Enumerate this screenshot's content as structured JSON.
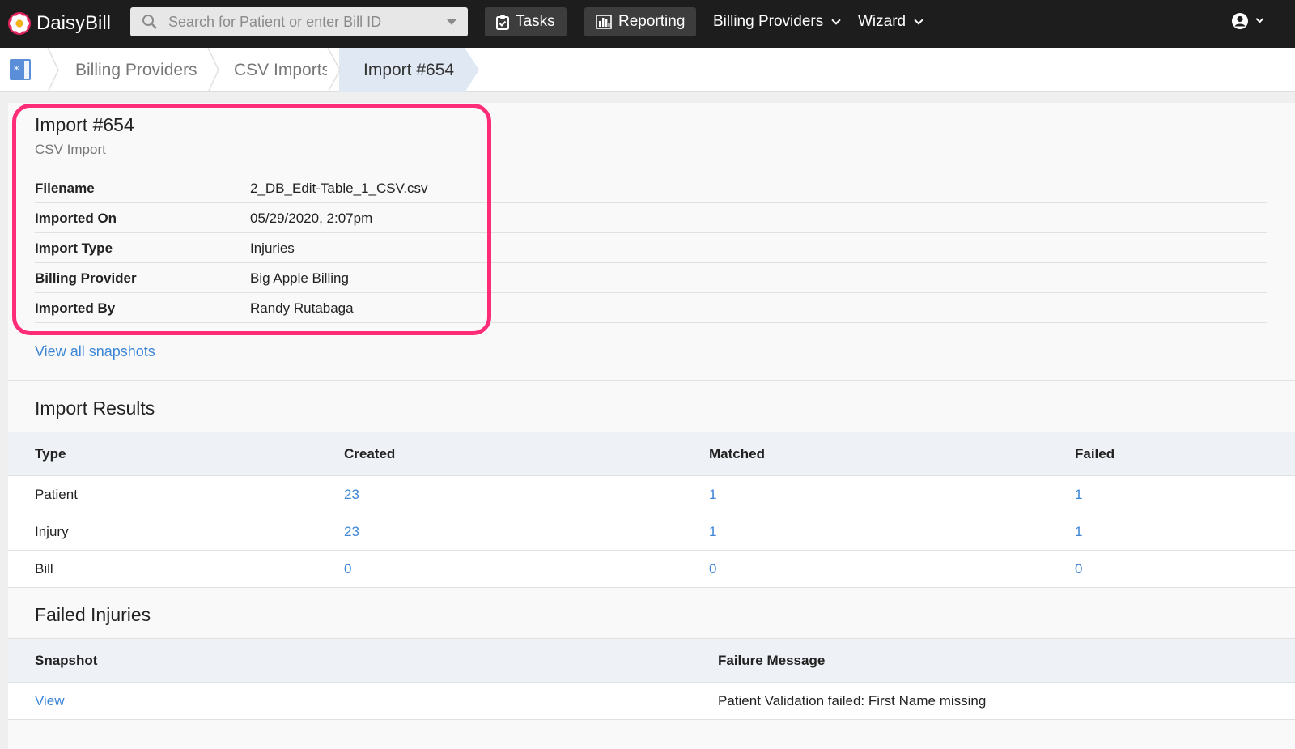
{
  "app": {
    "brand": "DaisyBill"
  },
  "search": {
    "placeholder": "Search for Patient or enter Bill ID"
  },
  "nav": {
    "tasks": "Tasks",
    "reporting": "Reporting",
    "billing_providers": "Billing Providers",
    "wizard": "Wizard"
  },
  "breadcrumb": [
    "Billing Providers",
    "CSV Imports",
    "Import #654"
  ],
  "import": {
    "title": "Import #654",
    "subtitle": "CSV Import",
    "fields": [
      {
        "label": "Filename",
        "value": "2_DB_Edit-Table_1_CSV.csv"
      },
      {
        "label": "Imported On",
        "value": "05/29/2020, 2:07pm"
      },
      {
        "label": "Import Type",
        "value": "Injuries"
      },
      {
        "label": "Billing Provider",
        "value": "Big Apple Billing"
      },
      {
        "label": "Imported By",
        "value": "Randy Rutabaga"
      }
    ],
    "view_snapshots": "View all snapshots"
  },
  "results": {
    "title": "Import Results",
    "columns": [
      "Type",
      "Created",
      "Matched",
      "Failed"
    ],
    "rows": [
      [
        "Patient",
        "23",
        "1",
        "1"
      ],
      [
        "Injury",
        "23",
        "1",
        "1"
      ],
      [
        "Bill",
        "0",
        "0",
        "0"
      ]
    ]
  },
  "failed": {
    "title": "Failed Injuries",
    "columns": [
      "Snapshot",
      "Failure Message"
    ],
    "rows": [
      [
        "View",
        "Patient Validation failed: First Name missing"
      ]
    ]
  },
  "colors": {
    "topbar": "#1d1d1d",
    "link": "#3d86d6",
    "highlight": "#ff2d78",
    "breadcrumb_active": "#e0e8f3"
  }
}
